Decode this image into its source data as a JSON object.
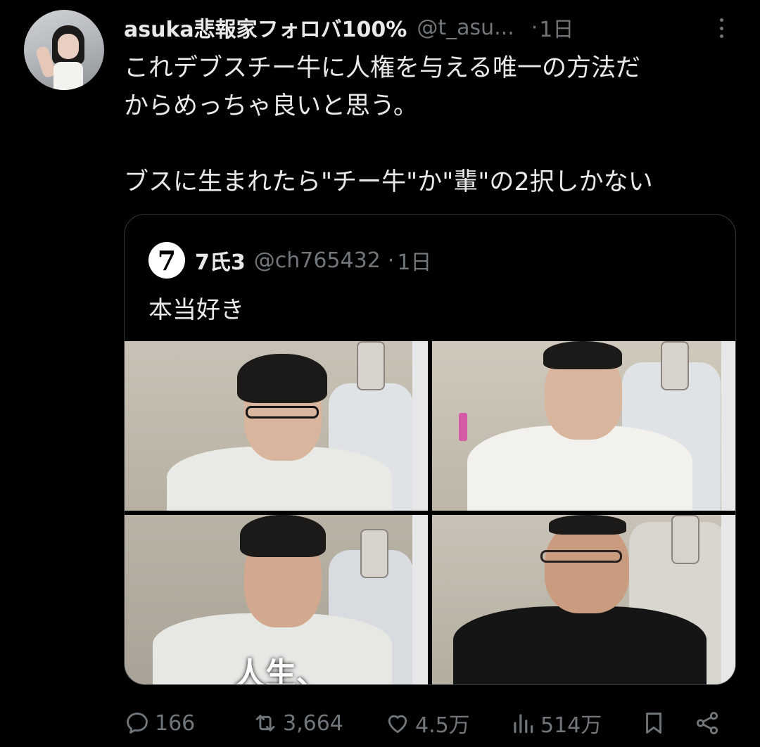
{
  "tweet": {
    "display_name": "asuka悲報家フォロバ100%",
    "handle": "@t_asu...",
    "dot": "·",
    "time": "1日",
    "text_lines": [
      "これデブスチー牛に人権を与える唯一の方法だ",
      "からめっちゃ良いと思う。",
      "",
      "ブスに生まれたら\"チー牛\"か\"輩\"の2択しかない"
    ]
  },
  "quote": {
    "avatar_glyph": "7",
    "display_name": "7氏3",
    "handle": "@ch765432",
    "dot": "·",
    "time": "1日",
    "text": "本当好き",
    "photo_overlay_texts": [
      "人生、"
    ]
  },
  "actions": {
    "reply_count": "166",
    "retweet_count": "3,664",
    "like_count": "4.5万",
    "view_count": "514万"
  },
  "colors": {
    "background": "#000000",
    "text_primary": "#e7e9ea",
    "text_secondary": "#71767b",
    "border": "#333639"
  }
}
